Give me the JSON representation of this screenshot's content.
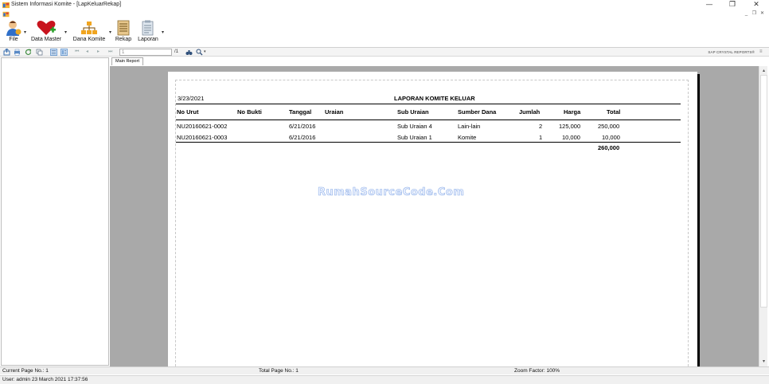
{
  "window": {
    "title": "Sistem Informasi Komite - [LapKeluarRekap]",
    "minimize_glyph": "—",
    "restore_glyph": "❐",
    "close_glyph": "✕"
  },
  "mdi_controls": {
    "minimize": "_",
    "restore": "❐",
    "close": "✕"
  },
  "menu": [
    {
      "label": "File",
      "icon": "user-icon"
    },
    {
      "label": "Data Master",
      "icon": "heart-icon"
    },
    {
      "label": "Dana Komite",
      "icon": "org-chart-icon"
    },
    {
      "label": "Rekap",
      "icon": "ledger-icon"
    },
    {
      "label": "Laporan",
      "icon": "report-icon"
    }
  ],
  "viewer_toolbar": {
    "page_input_value": "1",
    "page_total": "/1",
    "brand": "SAP CRYSTAL REPORTS®"
  },
  "tabs": {
    "main": "Main Report"
  },
  "report": {
    "date": "3/23/2021",
    "title": "LAPORAN KOMITE KELUAR",
    "headers": {
      "no_urut": "No Urut",
      "no_bukti": "No Bukti",
      "tanggal": "Tanggal",
      "uraian": "Uraian",
      "sub_uraian": "Sub Uraian",
      "sumber_dana": "Sumber Dana",
      "jumlah": "Jumlah",
      "harga": "Harga",
      "total": "Total"
    },
    "rows": [
      {
        "no_urut": "NU20160621-0002",
        "tanggal": "6/21/2016",
        "sub_uraian": "Sub Uraian 4",
        "sumber_dana": "Lain-lain",
        "jumlah": "2",
        "harga": "125,000",
        "total": "250,000"
      },
      {
        "no_urut": "NU20160621-0003",
        "tanggal": "6/21/2016",
        "sub_uraian": "Sub Uraian 1",
        "sumber_dana": "Komite",
        "jumlah": "1",
        "harga": "10,000",
        "total": "10,000"
      }
    ],
    "grand_total": "260,000",
    "watermark": "RumahSourceCode.Com"
  },
  "status": {
    "current_page": "Current Page No.: 1",
    "total_page": "Total Page No.: 1",
    "zoom": "Zoom Factor: 100%",
    "user": "User: admin  23 March 2021 17:37:56"
  },
  "colors": {
    "viewport_bg": "#a9a9a9",
    "paper": "#ffffff",
    "statusbar": "#f0f0f0"
  }
}
